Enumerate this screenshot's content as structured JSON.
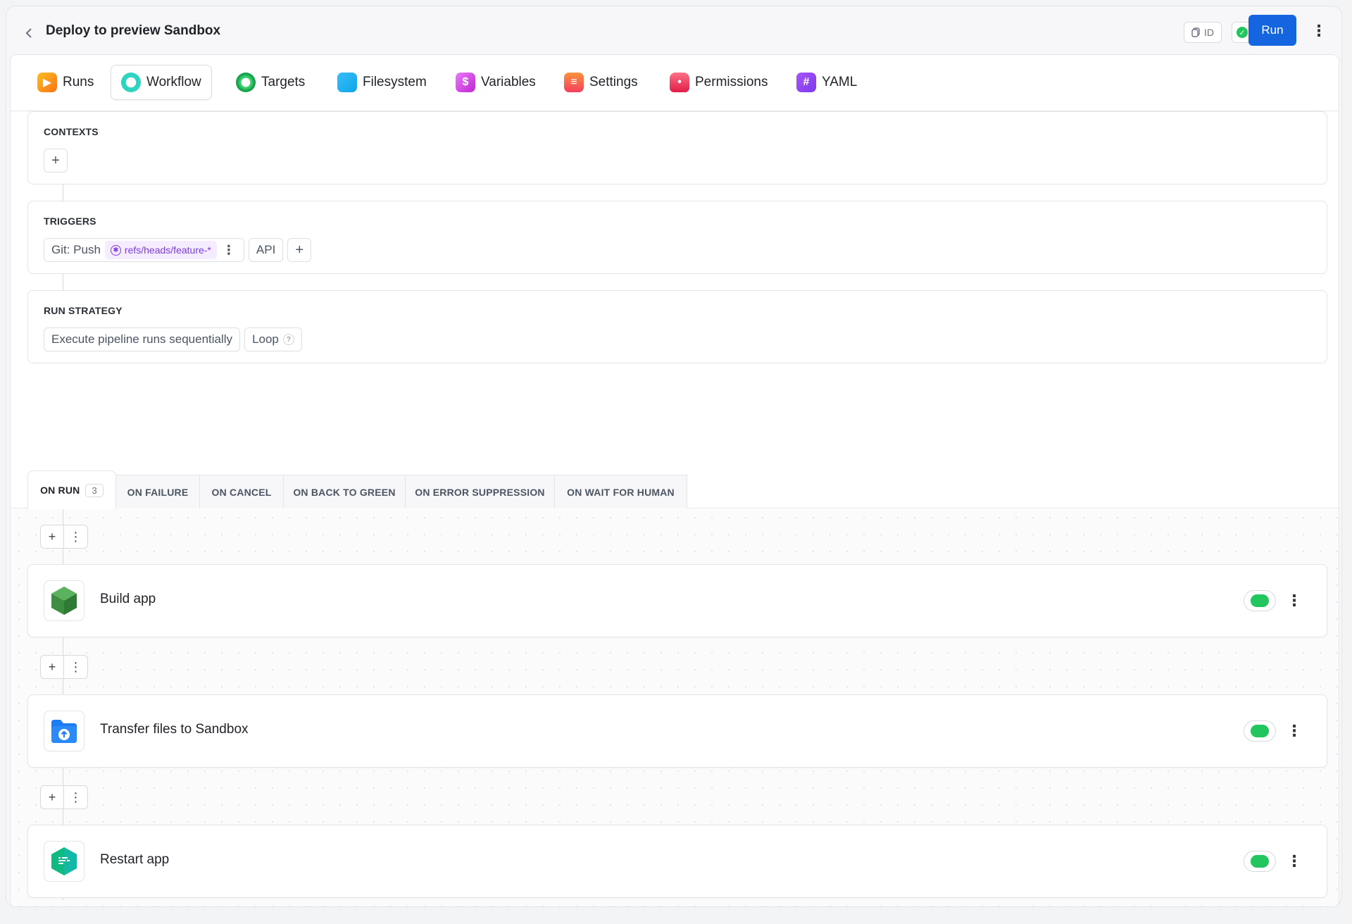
{
  "header": {
    "back_icon": "chevron-left-icon",
    "title": "Deploy to preview Sandbox",
    "id_label": "ID",
    "status_icon": "check-circle-icon",
    "run_label": "Run"
  },
  "tabs": [
    {
      "label": "Runs",
      "icon": "runs-icon",
      "active": false
    },
    {
      "label": "Workflow",
      "icon": "workflow-icon",
      "active": true
    },
    {
      "label": "Targets",
      "icon": "targets-icon",
      "active": false
    },
    {
      "label": "Filesystem",
      "icon": "filesystem-icon",
      "active": false
    },
    {
      "label": "Variables",
      "icon": "variables-icon",
      "active": false
    },
    {
      "label": "Settings",
      "icon": "settings-icon",
      "active": false
    },
    {
      "label": "Permissions",
      "icon": "permissions-icon",
      "active": false
    },
    {
      "label": "YAML",
      "icon": "yaml-icon",
      "active": false
    }
  ],
  "contexts": {
    "title": "CONTEXTS"
  },
  "triggers": {
    "title": "TRIGGERS",
    "git_push_label": "Git: Push",
    "ref_pattern": "refs/heads/feature-*",
    "api_label": "API"
  },
  "run_strategy": {
    "title": "RUN STRATEGY",
    "mode": "Execute pipeline runs sequentially",
    "loop_label": "Loop",
    "help": "?"
  },
  "event_tabs": [
    {
      "label": "ON RUN",
      "count": "3",
      "active": true
    },
    {
      "label": "ON FAILURE",
      "active": false
    },
    {
      "label": "ON CANCEL",
      "active": false
    },
    {
      "label": "ON BACK TO GREEN",
      "active": false
    },
    {
      "label": "ON ERROR SUPPRESSION",
      "active": false
    },
    {
      "label": "ON WAIT FOR HUMAN",
      "active": false
    }
  ],
  "actions": [
    {
      "name": "Build app",
      "icon": "nodejs-icon",
      "enabled": true
    },
    {
      "name": "Transfer files to Sandbox",
      "icon": "upload-folder-icon",
      "enabled": true
    },
    {
      "name": "Restart app",
      "icon": "sandbox-app-icon",
      "enabled": true
    }
  ],
  "colors": {
    "accent": "#1565e0",
    "toggle_on": "#22c55e",
    "ref_pill_text": "#7c3aed"
  }
}
